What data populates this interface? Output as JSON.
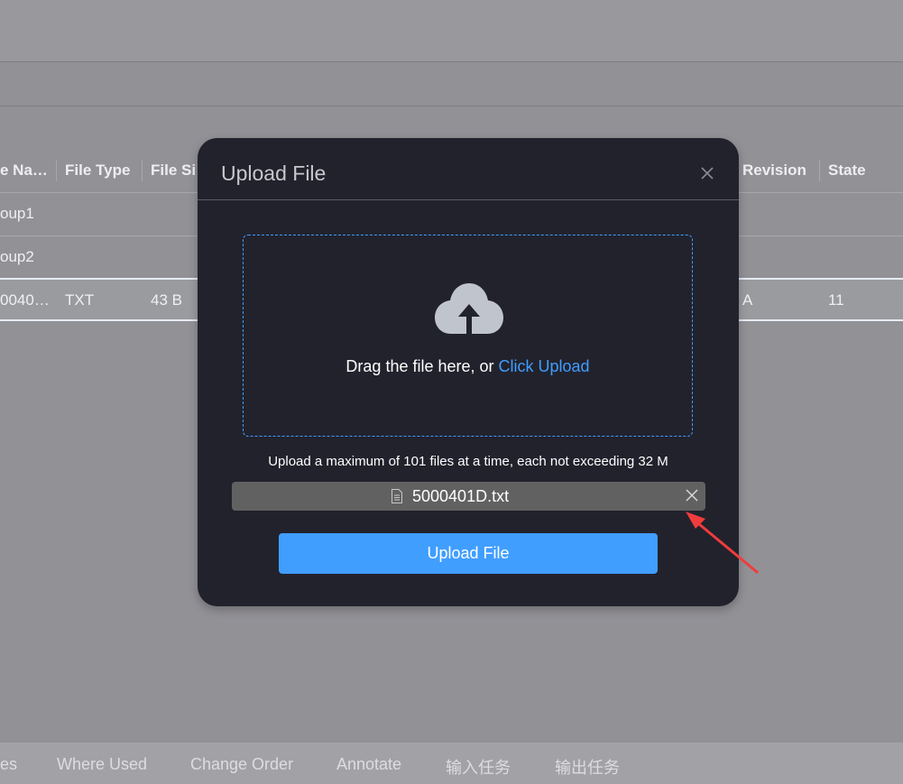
{
  "table": {
    "columns": [
      {
        "label": "e Na…"
      },
      {
        "label": "File Type"
      },
      {
        "label": "File Si"
      },
      {
        "label": "Revision"
      },
      {
        "label": "State"
      }
    ],
    "rows": [
      {
        "name": "oup1",
        "type": "",
        "size": "",
        "revision": "",
        "state": ""
      },
      {
        "name": "oup2",
        "type": "",
        "size": "",
        "revision": "",
        "state": ""
      },
      {
        "name": "0040…",
        "type": "TXT",
        "size": "43 B",
        "revision": "A",
        "state": "11"
      }
    ]
  },
  "bottom_tabs": [
    {
      "label": "es"
    },
    {
      "label": "Where Used"
    },
    {
      "label": "Change Order"
    },
    {
      "label": "Annotate"
    },
    {
      "label": "输入任务"
    },
    {
      "label": "输出任务"
    }
  ],
  "modal": {
    "title": "Upload File",
    "close_icon": "close-icon",
    "dropzone": {
      "icon": "cloud-upload-icon",
      "text": "Drag the file here, or ",
      "link": "Click Upload"
    },
    "limit_text": "Upload a maximum of 101 files at a time, each not exceeding 32 M",
    "file": {
      "icon": "document-icon",
      "name": "5000401D.txt",
      "remove_icon": "close-icon"
    },
    "submit_label": "Upload File"
  },
  "colors": {
    "accent": "#409eff",
    "modal_bg": "#22222d",
    "overlay": "#929196",
    "annotation": "#f03c3c"
  }
}
